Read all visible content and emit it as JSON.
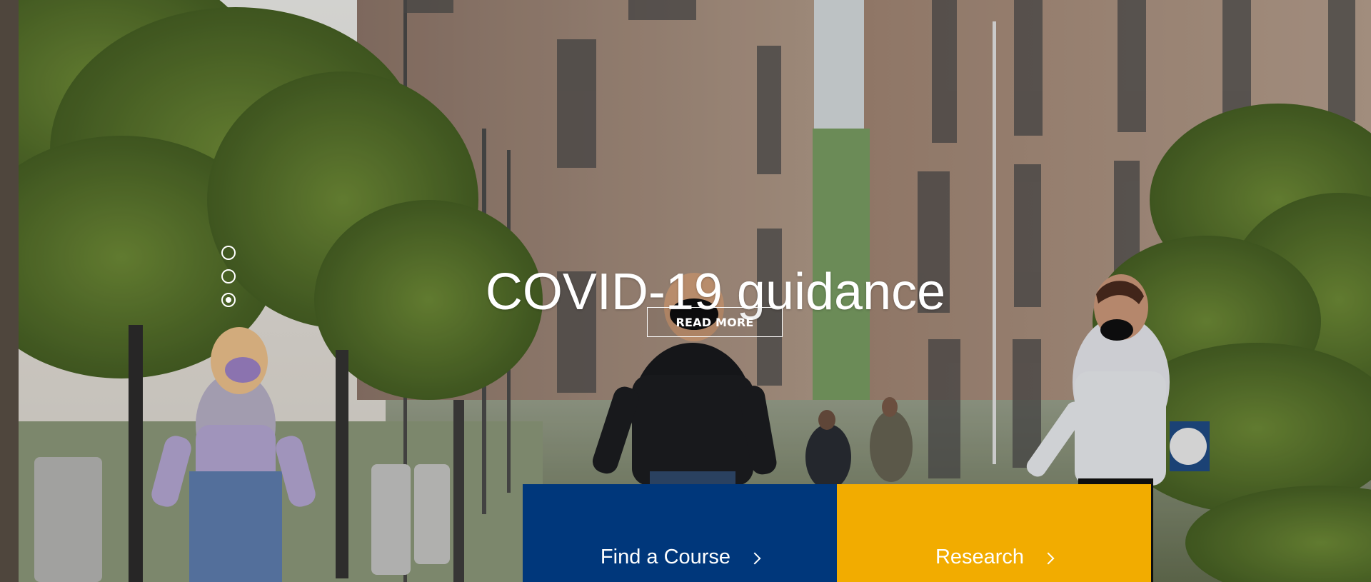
{
  "hero": {
    "title": "COVID-19 guidance",
    "button_label": "READ MORE",
    "active_slide": 3,
    "slides": 3
  },
  "actions": {
    "find_course": "Find a Course",
    "research": "Research"
  },
  "colors": {
    "primary_blue": "#00377b",
    "accent_yellow": "#f2ac00",
    "white": "#ffffff"
  },
  "icons": {
    "dots": "carousel-dot",
    "chevron": "chevron-right-icon"
  }
}
